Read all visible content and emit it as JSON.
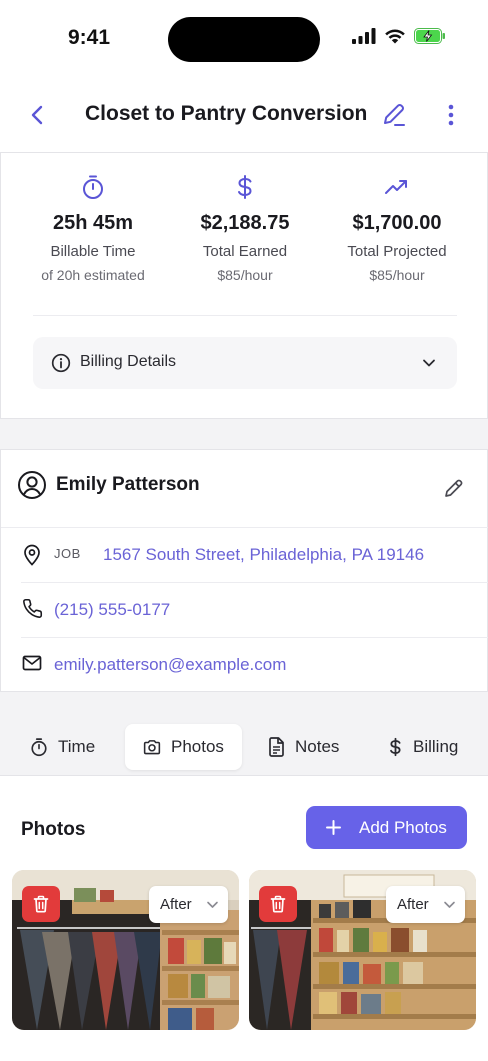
{
  "status_bar": {
    "time": "9:41"
  },
  "nav": {
    "title": "Closet to Pantry Conversion"
  },
  "stats": [
    {
      "icon": "stopwatch-icon",
      "value": "25h 45m",
      "label": "Billable Time",
      "sub": "of 20h estimated"
    },
    {
      "icon": "dollar-icon",
      "value": "$2,188.75",
      "label": "Total Earned",
      "sub": "$85/hour"
    },
    {
      "icon": "trending-up-icon",
      "value": "$1,700.00",
      "label": "Total Projected",
      "sub": "$85/hour"
    }
  ],
  "billing_details": {
    "label": "Billing Details"
  },
  "client": {
    "name": "Emily Patterson",
    "job_label": "JOB",
    "address": "1567 South Street, Philadelphia, PA 19146",
    "phone": "(215) 555-0177",
    "email": "emily.patterson@example.com"
  },
  "tabs": [
    {
      "label": "Time",
      "icon": "stopwatch-icon"
    },
    {
      "label": "Photos",
      "icon": "camera-icon",
      "active": true
    },
    {
      "label": "Notes",
      "icon": "document-icon"
    },
    {
      "label": "Billing",
      "icon": "dollar-icon"
    }
  ],
  "photos": {
    "heading": "Photos",
    "add_label": "Add Photos",
    "items": [
      {
        "tag": "After"
      },
      {
        "tag": "After"
      }
    ]
  },
  "colors": {
    "accent": "#6762e8",
    "link": "#6a63d6",
    "danger": "#e23b3b"
  }
}
